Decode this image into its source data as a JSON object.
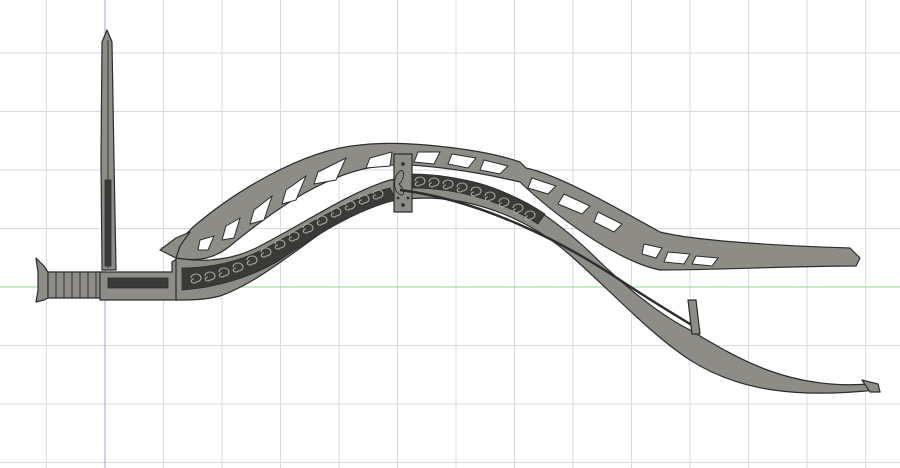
{
  "canvas": {
    "background": "#ffffff",
    "grid_color": "#d7dbe2",
    "axis_x_color": "#8fd48f",
    "axis_y_color": "#9aa3d8",
    "model_fill": "#8e8c87",
    "model_fill_light": "#a8a6a0",
    "model_stroke": "#2c2c2c",
    "model_dark": "#3a3a38"
  },
  "model": {
    "kind": "bow-staff-3d-model",
    "parts": [
      "staff-blade",
      "staff-grip",
      "bow-upper-limb",
      "bow-riser",
      "bow-lower-limb",
      "string"
    ]
  }
}
